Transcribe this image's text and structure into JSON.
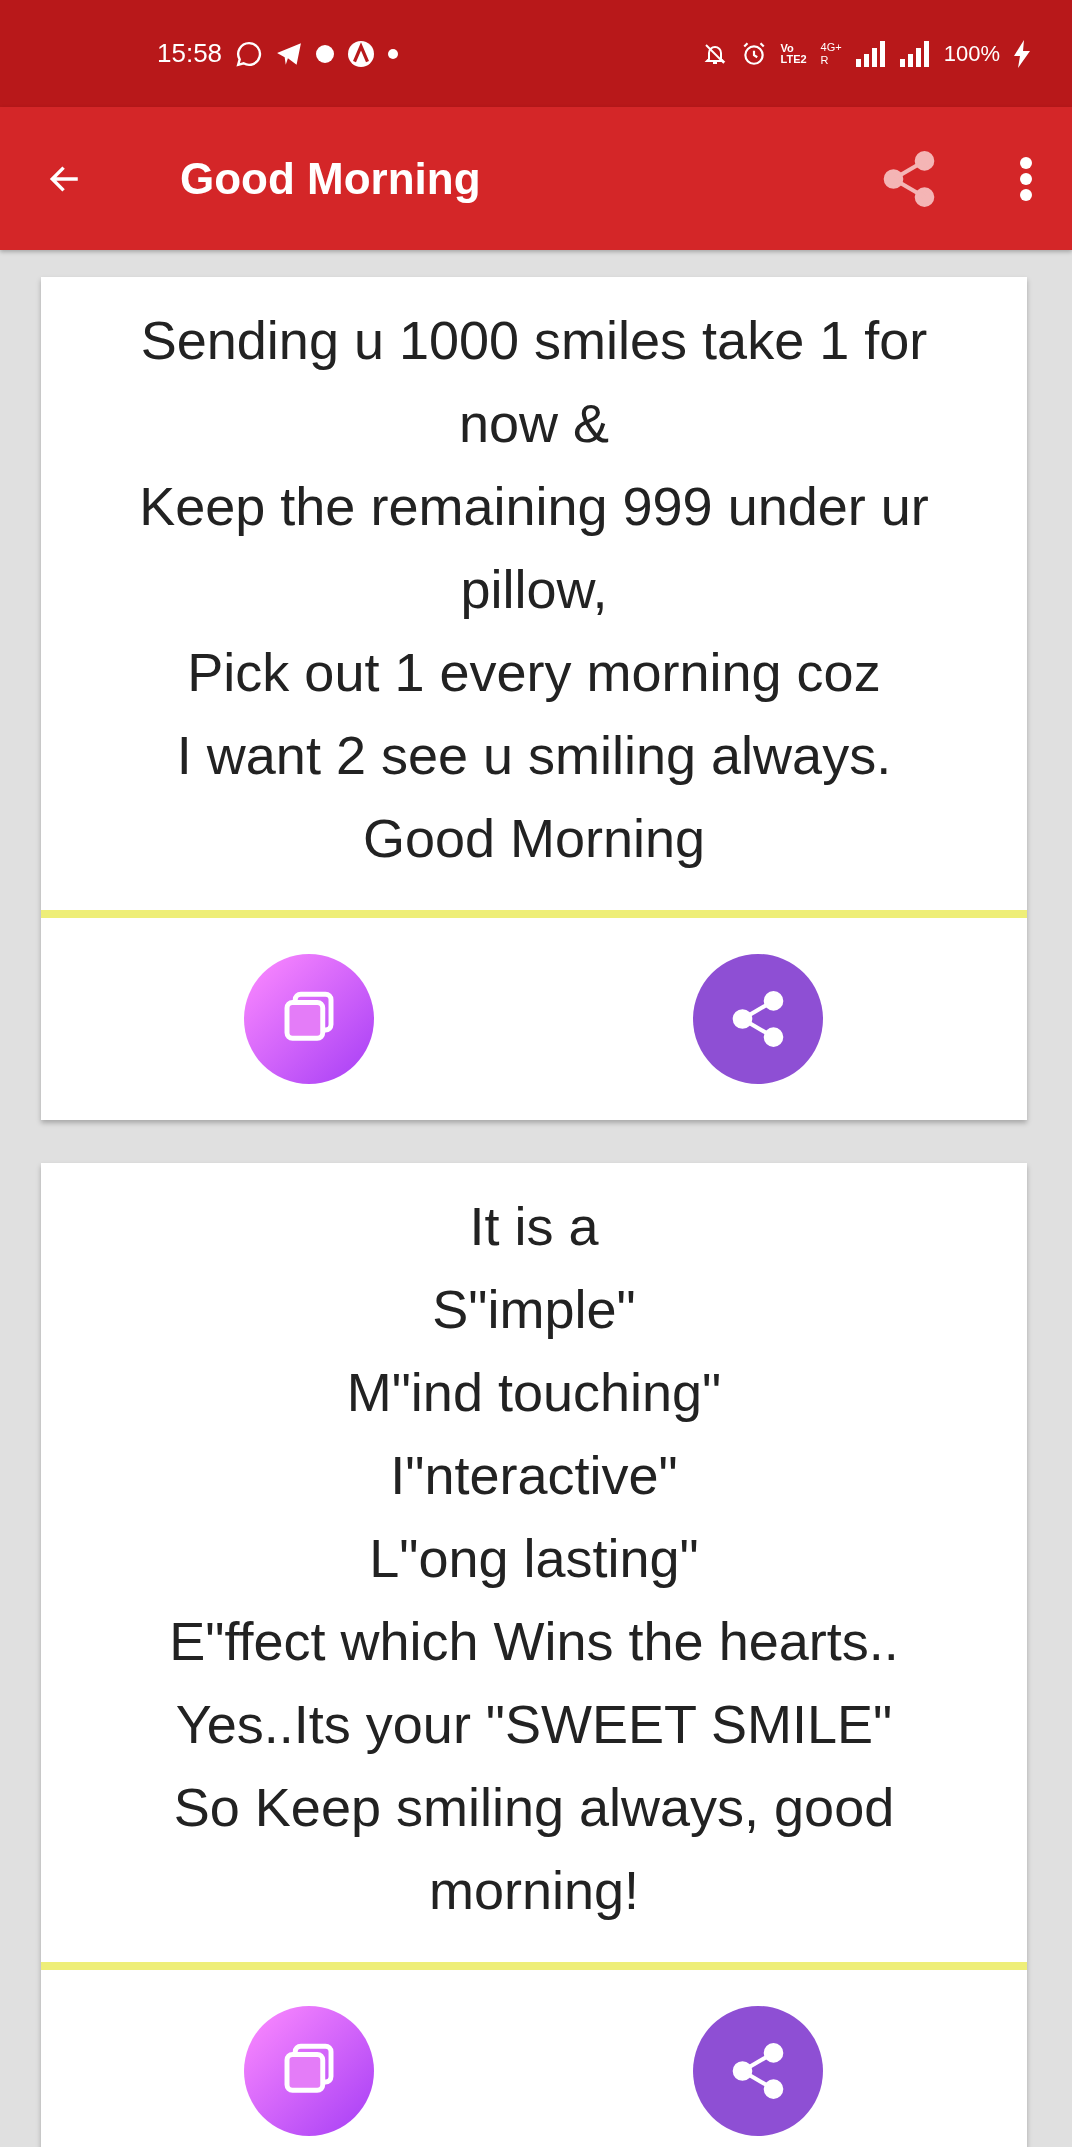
{
  "status_bar": {
    "time": "15:58",
    "volte": [
      "Vo",
      "LTE2"
    ],
    "network": "4G+",
    "roaming": "R",
    "battery": "100%"
  },
  "app_bar": {
    "title": "Good Morning"
  },
  "cards": [
    {
      "lines": [
        "Sending u 1000 smiles take 1 for",
        "now &",
        "Keep the remaining 999 under ur",
        "pillow,",
        "Pick out 1 every morning coz",
        "I want 2 see u smiling always.",
        "Good Morning"
      ]
    },
    {
      "lines": [
        "It is a",
        "S\"imple\"",
        "M\"ind touching\"",
        "I\"nteractive\"",
        "L\"ong lasting\"",
        "E\"ffect which Wins the hearts..",
        "Yes..Its your \"SWEET SMILE\"",
        "So Keep smiling always, good",
        "morning!"
      ]
    }
  ]
}
